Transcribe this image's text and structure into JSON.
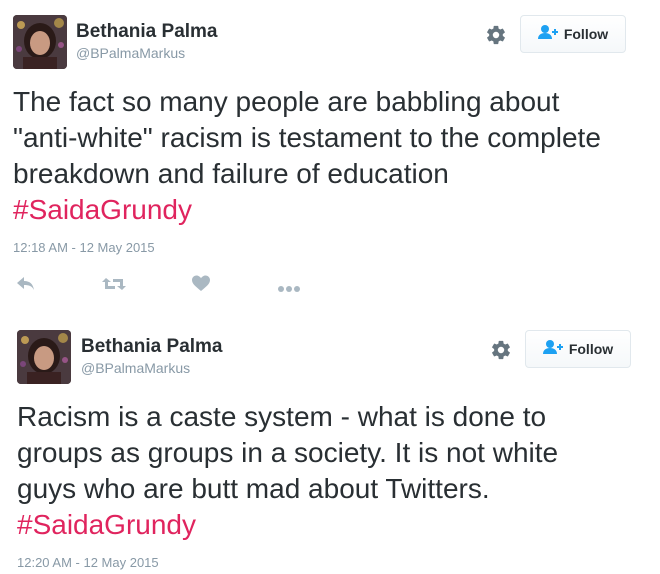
{
  "tweets": [
    {
      "author_name": "Bethania Palma",
      "handle": "@BPalmaMarkus",
      "follow_label": "Follow",
      "text_lines": [
        "The fact so many people are babbling about",
        "\"anti-white\" racism is testament to the complete",
        "breakdown and failure of education"
      ],
      "hashtag": "#SaidaGrundy",
      "timestamp": "12:18 AM - 12 May 2015",
      "actions": [
        "reply-icon",
        "retweet-icon",
        "like-heart-icon",
        "more-dots-icon"
      ]
    },
    {
      "author_name": "Bethania Palma",
      "handle": "@BPalmaMarkus",
      "follow_label": "Follow",
      "text_lines": [
        "Racism is a caste system - what is done to",
        "groups as groups in a society. It is not white",
        "guys who are butt mad about Twitters."
      ],
      "hashtag": "#SaidaGrundy",
      "timestamp": "12:20 AM - 12 May 2015"
    }
  ],
  "colors": {
    "hashtag": "#e0245e",
    "muted": "#8899a6",
    "follow_icon": "#1da1f2",
    "text": "#292f33"
  }
}
